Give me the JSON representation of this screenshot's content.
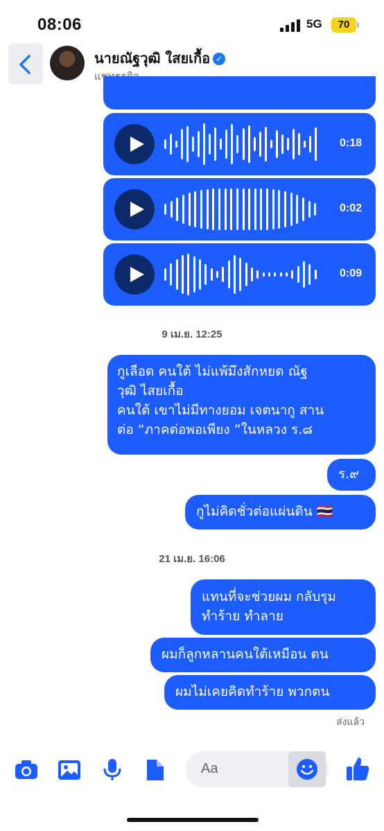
{
  "status_bar": {
    "time": "08:06",
    "network": "5G",
    "battery": "70"
  },
  "header": {
    "contact_name": "นายณัฐวุฒิ ใสยเกื้อ",
    "subtitle": "แชทธุรกิจ",
    "verified_icon": "verified-badge-icon"
  },
  "voice_messages": [
    {
      "duration": "0:18"
    },
    {
      "duration": "0:02"
    },
    {
      "duration": "0:09"
    }
  ],
  "timestamps": {
    "first": "9 เม.ย. 12:25",
    "second": "21 เม.ย. 16:06"
  },
  "messages": [
    {
      "lines": [
        "กูเลือด คนใต้ ไม่แพ้มึงสักหยด ณัฐ",
        "วุฒิ ไสยเกื้อ",
        "คนใต้ เขาไม่มีทางยอม เจตนากู สาน",
        "ต่อ “ภาคต่อพอเพียง ”ในหลวง ร.๘"
      ]
    },
    {
      "lines": [
        "ร.๙"
      ]
    },
    {
      "lines": [
        "กูไม่คิดชั่วต่อแผ่นดิน 🇹🇭"
      ]
    },
    {
      "lines": [
        "แทนที่จะช่วยผม กลับรุม",
        "ทำร้าย ทำลาย"
      ]
    },
    {
      "lines": [
        "ผมก็ลูกหลานคนใต้เหมือน ตน"
      ]
    },
    {
      "lines": [
        "ผมไม่เคยคิดทำร้าย พวกตน"
      ]
    }
  ],
  "sent_status": "ส่งแล้ว",
  "composer": {
    "placeholder": "Aa",
    "icons": [
      "camera-icon",
      "photo-icon",
      "microphone-icon",
      "file-icon",
      "emoji-icon",
      "like-icon"
    ]
  },
  "colors": {
    "bubble": "#1d5cff",
    "play_button": "#0d2b6b",
    "accent": "#1877f2"
  }
}
